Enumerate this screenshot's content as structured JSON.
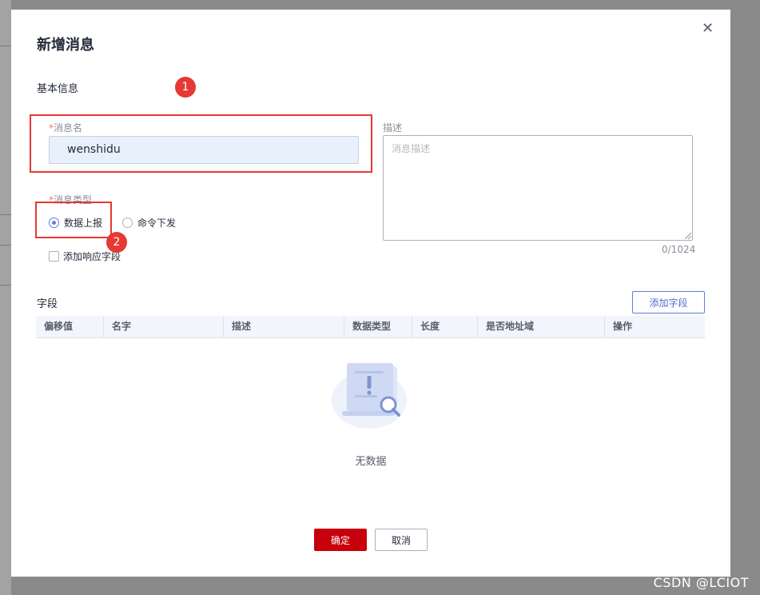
{
  "dialog": {
    "title": "新增消息",
    "close_glyph": "✕"
  },
  "basic_info": {
    "heading": "基本信息",
    "name": {
      "required_mark": "*",
      "label": "消息名",
      "value": "wenshidu"
    },
    "description": {
      "label": "描述",
      "placeholder": "消息描述",
      "counter": "0/1024"
    },
    "type": {
      "required_mark": "*",
      "label": "消息类型",
      "options": [
        {
          "label": "数据上报",
          "selected": true
        },
        {
          "label": "命令下发",
          "selected": false
        }
      ]
    },
    "response_field": {
      "label": "添加响应字段",
      "checked": false
    }
  },
  "fields": {
    "heading": "字段",
    "add_button": "添加字段",
    "columns": [
      "偏移值",
      "名字",
      "描述",
      "数据类型",
      "长度",
      "是否地址域",
      "操作"
    ],
    "empty_text": "无数据"
  },
  "footer": {
    "ok_label": "确定",
    "cancel_label": "取消"
  },
  "annotations": {
    "badge_1": "1",
    "badge_2": "2",
    "color": "#e53935"
  },
  "watermark": "CSDN @LCIOT",
  "colors": {
    "primary": "#5e7ce0",
    "ok_button": "#c7000b",
    "input_bg": "#e8f0fc"
  }
}
